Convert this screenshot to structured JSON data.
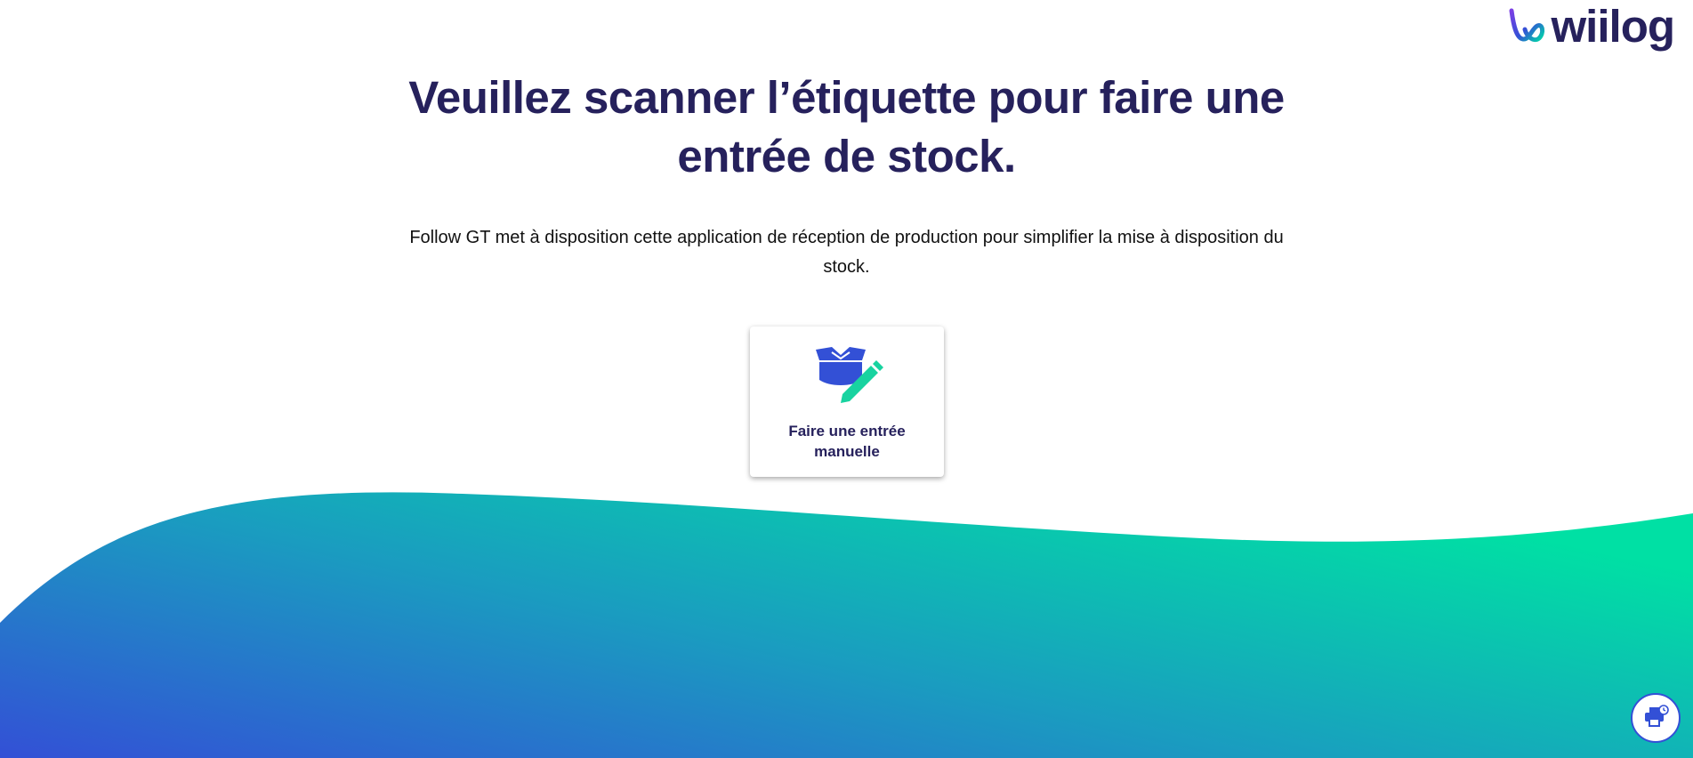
{
  "logo": {
    "text": "wiilog",
    "icon": "wiilog-loop-logo"
  },
  "header": {
    "title": "Veuillez scanner l’étiquette pour faire une entrée de stock.",
    "subtitle": "Follow GT met à disposition cette application de réception de production pour simplifier la mise à disposition du stock."
  },
  "manual_entry": {
    "label": "Faire une entrée manuelle",
    "icon": "box-pencil-icon"
  },
  "printer_button": {
    "icon": "printer-clock-icon"
  },
  "colors": {
    "title": "#26215c",
    "gradient_start": "#3350d6",
    "gradient_end": "#00e0a4",
    "box_icon": "#3350d6",
    "pencil_icon": "#18d3a0"
  }
}
